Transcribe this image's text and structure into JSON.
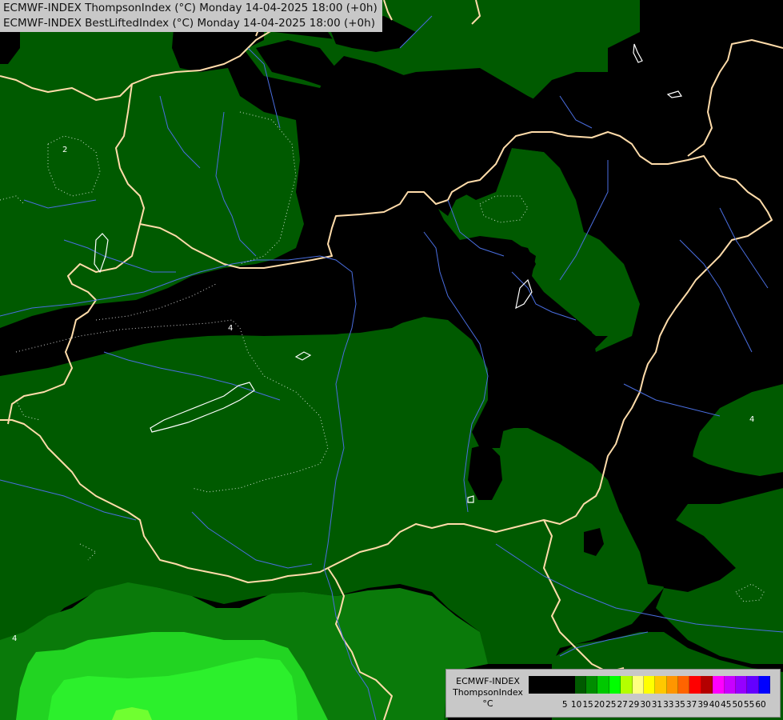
{
  "title_lines": [
    "ECMWF-INDEX ThompsonIndex (°C) Monday 14-04-2025 18:00 (+0h)",
    "ECMWF-INDEX BestLiftedIndex (°C) Monday 14-04-2025 18:00 (+0h)"
  ],
  "legend": {
    "source": "ECMWF-INDEX",
    "parameter": "ThompsonIndex",
    "unit": "°C",
    "swatches": [
      "#000000",
      "#000000",
      "#000000",
      "#000000",
      "#005a00",
      "#008c00",
      "#00c800",
      "#00ff00",
      "#b4ff00",
      "#ffff80",
      "#ffff00",
      "#ffc800",
      "#ff9600",
      "#ff6400",
      "#ff0000",
      "#b40000",
      "#ff00ff",
      "#c800ff",
      "#9600ff",
      "#6400ff",
      "#0000ff"
    ],
    "tick_labels": [
      "5",
      "10",
      "15",
      "20",
      "25",
      "27",
      "29",
      "30",
      "31",
      "33",
      "35",
      "37",
      "39",
      "40",
      "45",
      "50",
      "55",
      "60"
    ]
  },
  "map": {
    "colors": {
      "background": "#000000",
      "level_20": "#005a00",
      "level_25": "#0a7a0a",
      "level_27": "#0bb80b",
      "level_29": "#22e822",
      "level_30": "#90ff30",
      "borders": "#ffdcaa",
      "rivers": "#4a6ee0",
      "contours": "#ffffff"
    },
    "contour_labels": [
      "4",
      "4",
      "2",
      "4"
    ]
  }
}
